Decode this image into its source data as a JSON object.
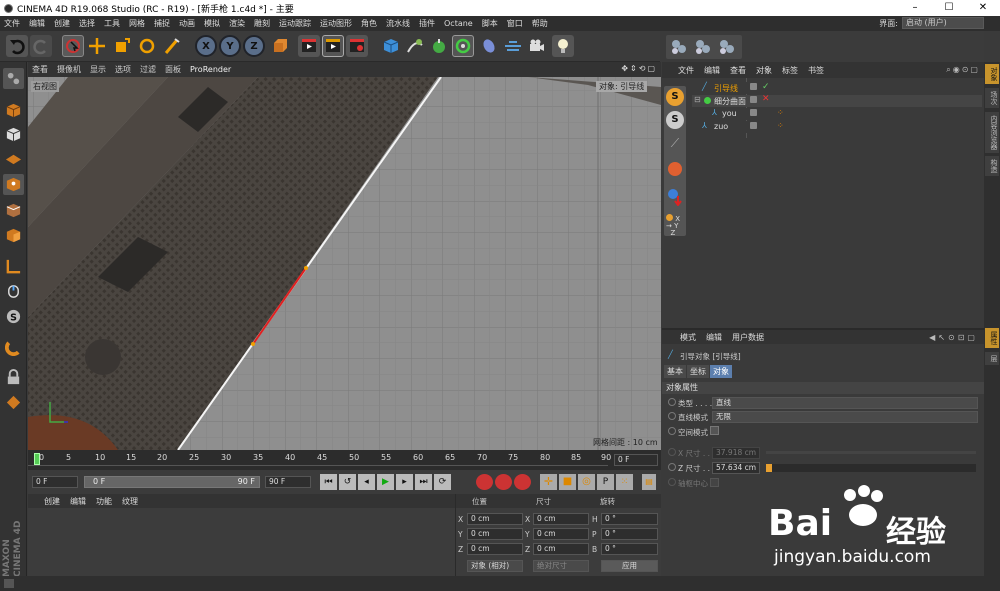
{
  "window": {
    "title": "CINEMA 4D R19.068 Studio (RC - R19) - [新手枪 1.c4d *] - 主要",
    "minimize": "–",
    "maximize": "☐",
    "close": "✕"
  },
  "menu": [
    "文件",
    "编辑",
    "创建",
    "选择",
    "工具",
    "网格",
    "捕捉",
    "动画",
    "模拟",
    "渲染",
    "雕刻",
    "运动跟踪",
    "运动图形",
    "角色",
    "流水线",
    "插件",
    "Octane",
    "脚本",
    "窗口",
    "帮助"
  ],
  "layout": {
    "label": "界面:",
    "value": "启动 (用户)"
  },
  "viewport": {
    "menu": [
      "查看",
      "摄像机",
      "显示",
      "选项",
      "过滤",
      "面板",
      "ProRender"
    ],
    "camera_label": "右视图",
    "object_label": "对象: 引导线",
    "grid_info": "网格间距 : 10 cm"
  },
  "timeline": {
    "ticks": [
      "0",
      "5",
      "10",
      "15",
      "20",
      "25",
      "30",
      "35",
      "40",
      "45",
      "50",
      "55",
      "60",
      "65",
      "70",
      "75",
      "80",
      "85",
      "90"
    ],
    "end": "0 F"
  },
  "playback": {
    "start": "0 F",
    "current": "0 F",
    "range_end": "90 F",
    "end": "90 F"
  },
  "materials": {
    "menu": [
      "创建",
      "编辑",
      "功能",
      "纹理"
    ]
  },
  "coords": {
    "headers": {
      "pos": "位置",
      "size": "尺寸",
      "rot": "旋转"
    },
    "rows": [
      {
        "axis": "X",
        "pos": "0 cm",
        "saxis": "X",
        "size": "0 cm",
        "raxis": "H",
        "rot": "0 °"
      },
      {
        "axis": "Y",
        "pos": "0 cm",
        "saxis": "Y",
        "size": "0 cm",
        "raxis": "P",
        "rot": "0 °"
      },
      {
        "axis": "Z",
        "pos": "0 cm",
        "saxis": "Z",
        "size": "0 cm",
        "raxis": "B",
        "rot": "0 °"
      }
    ],
    "mode": "对象 (相对)",
    "size_mode": "绝对尺寸",
    "apply": "应用"
  },
  "objmgr": {
    "menu": [
      "文件",
      "编辑",
      "查看",
      "对象",
      "标签",
      "书签"
    ],
    "objects": [
      {
        "name": "引导线",
        "indent": 0
      },
      {
        "name": "细分曲面",
        "indent": 0
      },
      {
        "name": "you",
        "indent": 1
      },
      {
        "name": "zuo",
        "indent": 0
      }
    ]
  },
  "attr": {
    "menu": [
      "模式",
      "编辑",
      "用户数据"
    ],
    "title": "引导对象 [引导线]",
    "tabs": [
      "基本",
      "坐标",
      "对象"
    ],
    "section": "对象属性",
    "type_label": "类型 . . . . .",
    "type_value": "直线",
    "mode_label": "直线模式",
    "mode_value": "无限",
    "space_label": "空间模式",
    "xsize_label": "X 尺寸 . . .",
    "xsize_value": "37.918 cm",
    "zsize_label": "Z 尺寸 . . .",
    "zsize_value": "57.634 cm",
    "zsize_fill": 0.03,
    "pivot_label": "轴枢中心"
  },
  "right_tabs": [
    "对象",
    "场次",
    "内容浏览器",
    "构造",
    "属性",
    "层"
  ],
  "branding": {
    "line1": "MAXON",
    "line2": "CINEMA 4D"
  },
  "watermark": {
    "text1": "Bai",
    "text2": "经验",
    "url": "jingyan.baidu.com"
  }
}
